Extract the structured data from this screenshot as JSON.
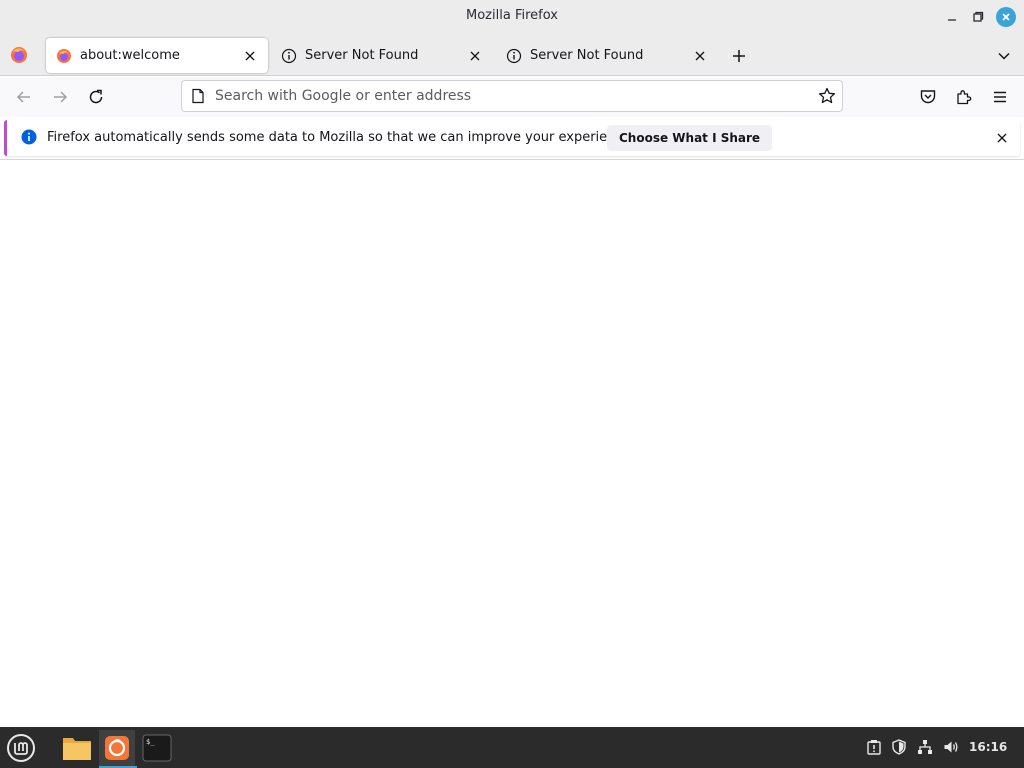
{
  "window": {
    "title": "Mozilla Firefox"
  },
  "tabs": [
    {
      "label": "about:welcome",
      "icon": "firefox-icon",
      "active": true
    },
    {
      "label": "Server Not Found",
      "icon": "info-icon",
      "active": false
    },
    {
      "label": "Server Not Found",
      "icon": "info-icon",
      "active": false
    }
  ],
  "urlbar": {
    "placeholder": "Search with Google or enter address",
    "value": ""
  },
  "notification": {
    "message": "Firefox automatically sends some data to Mozilla so that we can improve your experience.",
    "button_label": "Choose What I Share",
    "accent_color": "#c04bd0"
  },
  "taskbar": {
    "apps": [
      "mint-menu-icon",
      "files-icon",
      "firefox-icon",
      "terminal-icon"
    ],
    "tray": [
      "update-manager-icon",
      "shield-icon",
      "network-icon",
      "volume-icon"
    ],
    "clock": "16:16"
  },
  "colors": {
    "accent": "#3aa4d8",
    "taskbar": "#2b2b2b"
  }
}
